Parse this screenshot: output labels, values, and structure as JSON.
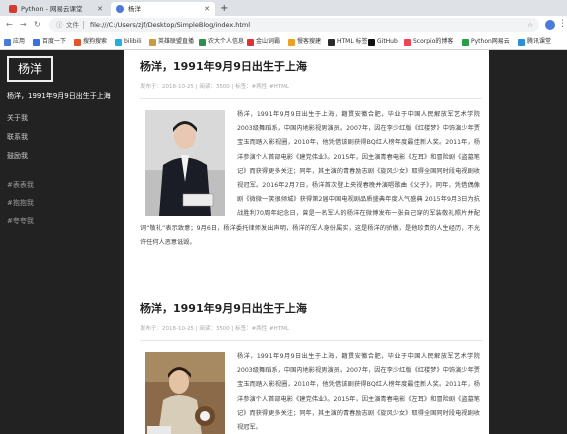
{
  "browser": {
    "tabs": [
      {
        "title": "Python - 网易云课堂",
        "active": false
      },
      {
        "title": "杨洋",
        "active": true
      }
    ],
    "omnibox": {
      "security_label": "文件",
      "url": "file:///C:/Users/zjf/Desktop/SimpleBlog/index.html"
    },
    "bookmarks": [
      {
        "label": "应用",
        "color": "#4a7bd8"
      },
      {
        "label": "百度一下",
        "color": "#3a6fe0"
      },
      {
        "label": "搜狗搜索",
        "color": "#e0572d"
      },
      {
        "label": "bilibili",
        "color": "#23ade5"
      },
      {
        "label": "英雄联盟直播",
        "color": "#c89b3c"
      },
      {
        "label": "农大个人信息",
        "color": "#2f8f4e"
      },
      {
        "label": "金山词霸",
        "color": "#d33"
      },
      {
        "label": "慢客搜建",
        "color": "#f0a020"
      },
      {
        "label": "HTML 标签",
        "color": "#2a2a2a"
      },
      {
        "label": "GitHub",
        "color": "#111"
      },
      {
        "label": "Scorpio的博客",
        "color": "#e45"
      },
      {
        "label": "Python网易云",
        "color": "#2c9f45"
      },
      {
        "label": "腾讯课堂",
        "color": "#2a8fe0"
      }
    ]
  },
  "sidebar": {
    "logo": "杨洋",
    "subtitle": "杨洋，1991年9月9日出生于上海",
    "nav": [
      "关于我",
      "联系我",
      "鼓励我"
    ],
    "tags": [
      "#表表我",
      "#抱抱我",
      "#夸夸我"
    ]
  },
  "posts": [
    {
      "title": "杨洋，1991年9月9日出生于上海",
      "meta": "发布于：2018-10-25 | 阅读：3500 | 标签：#两性 #HTML",
      "text": "杨洋，1991年9月9日出生于上海，籍贯安徽合肥，毕业于中国人民解放军艺术学院2003级舞蹈系，中国内地影视男演员。2007年，因在李少红版《红楼梦》中饰演少年贾宝玉而踏入影视圈，2010年，他凭借该剧获得BQ红人榜年度最佳新人奖。2011年，杨洋参演个人首部电影《建党伟业》。2015年，因主演青春电影《左耳》和冒险剧《盗墓笔记》而获得更多关注；同年，其主演的青春励志剧《旋风少女》取得全国同时段电视剧收视冠军。2016年2月7日，杨洋首次登上央视春晚并演唱歌曲《父子》，同年，凭借偶像剧《微微一笑很倾城》获得第2届中国电视剧品质盛典年度人气盛典 2015年9月3日为抗战胜利70周年纪念日，曾是一名军人的杨洋在微博发布一张自己穿的军装敬礼照片并配词“敬礼”表示致意；9月6日，杨洋委托律师发出声明，杨洋的军人身份属实，这是杨洋的骄傲，是他珍贵的人生经历，不允许任何人恶意诋毁。"
    },
    {
      "title": "杨洋，1991年9月9日出生于上海",
      "meta": "发布于：2018-10-25 | 阅读：3500 | 标签：#两性 #HTML",
      "text": "杨洋，1991年9月9日出生于上海，籍贯安徽合肥，毕业于中国人民解放军艺术学院2003级舞蹈系，中国内地影视男演员。2007年，因在李少红版《红楼梦》中饰演少年贾宝玉而踏入影视圈，2010年，他凭借该剧获得BQ红人榜年度最佳新人奖。2011年，杨洋参演个人首部电影《建党伟业》。2015年，因主演青春电影《左耳》和冒险剧《盗墓笔记》而获得更多关注；同年，其主演的青春励志剧《旋风少女》取得全国同时段电视剧收视冠军。"
    }
  ]
}
